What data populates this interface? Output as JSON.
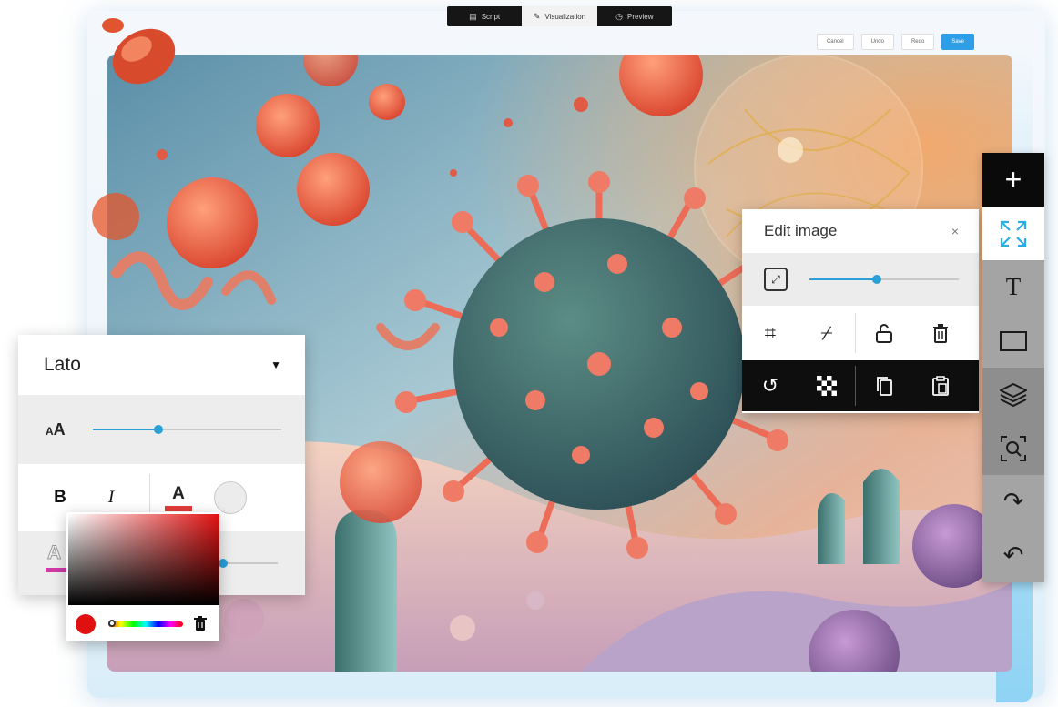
{
  "tabs": [
    {
      "label": "Script",
      "icon": "script-icon"
    },
    {
      "label": "Visualization",
      "icon": "edit-square-icon",
      "active": true
    },
    {
      "label": "Preview",
      "icon": "clock-icon"
    }
  ],
  "topbar": {
    "cancel": "Cancel",
    "undo": "Undo",
    "redo": "Redo",
    "save": "Save"
  },
  "edit_panel": {
    "title": "Edit image",
    "close": "×",
    "zoom_level": 0.45,
    "tools_row1": [
      "crop-icon",
      "crop-off-icon",
      "unlock-icon",
      "trash-icon"
    ],
    "tools_row2": [
      "rotate-icon",
      "transparency-icon",
      "copy-icon",
      "paste-icon"
    ]
  },
  "right_toolbar": [
    "add-icon",
    "expand-icon",
    "text-icon",
    "rectangle-icon",
    "layers-icon",
    "zoom-icon",
    "redo-icon",
    "undo-icon"
  ],
  "font_panel": {
    "font": "Lato",
    "size_level": 0.35,
    "bold": "B",
    "italic": "I",
    "text_color_glyph": "A",
    "size_glyph_small": "A",
    "size_glyph_large": "A",
    "outline_glyph": "A",
    "text_color": "#e23b3b",
    "outline_color": "#d03aa7"
  },
  "color_picker": {
    "selected": "#e01010",
    "hue_level": 0.0
  },
  "colors": {
    "accent": "#2a9fd8",
    "save": "#2e9ee6"
  }
}
